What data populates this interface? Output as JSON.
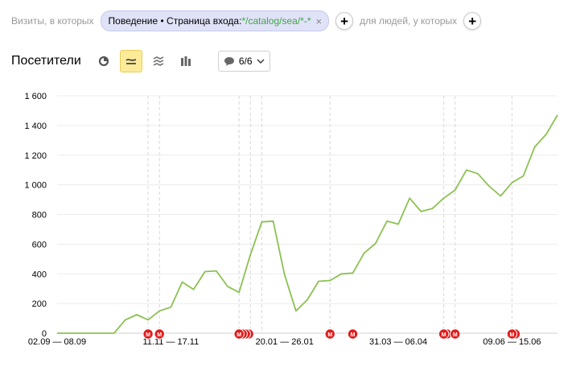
{
  "filters": {
    "visits_label": "Визиты, в которых",
    "segment": {
      "prefix": "Поведение • Страница входа: ",
      "value": "*/catalog/sea/*-*"
    },
    "people_label": "для людей, у которых",
    "add_symbol": "+",
    "remove_symbol": "×"
  },
  "toolbar": {
    "metric_title": "Посетители",
    "view_modes": [
      "pie-chart-icon",
      "line-chart-icon",
      "area-chart-icon",
      "bar-chart-icon"
    ],
    "active_view": "line-chart-icon",
    "notes_label": "6/6",
    "accent": "#fdeb9a"
  },
  "chart_data": {
    "type": "line",
    "color": "#8cc152",
    "ylim": [
      0,
      1600
    ],
    "yticks": [
      "0",
      "200",
      "400",
      "600",
      "800",
      "1 000",
      "1 200",
      "1 400",
      "1 600"
    ],
    "xtick_labels": [
      "02.09 — 08.09",
      "11.11 — 17.11",
      "20.01 — 26.01",
      "31.03 — 06.04",
      "09.06 — 15.06"
    ],
    "xtick_index": [
      0,
      10,
      20,
      30,
      40
    ],
    "values": [
      0,
      0,
      0,
      0,
      0,
      0,
      90,
      125,
      90,
      150,
      175,
      345,
      295,
      415,
      420,
      315,
      275,
      530,
      750,
      755,
      395,
      150,
      225,
      350,
      355,
      400,
      405,
      540,
      605,
      755,
      735,
      910,
      820,
      840,
      910,
      965,
      1100,
      1075,
      990,
      925,
      1015,
      1060,
      1255,
      1340,
      1470
    ],
    "grid": true,
    "note_marker_letter": "М",
    "note_marker_color": "#e01d1d",
    "note_groups": [
      {
        "index": 8,
        "count": 1
      },
      {
        "index": 9,
        "count": 1
      },
      {
        "index": 16,
        "count": 4
      },
      {
        "index": 24,
        "count": 1
      },
      {
        "index": 26,
        "count": 1
      },
      {
        "index": 34,
        "count": 2
      },
      {
        "index": 35,
        "count": 1
      },
      {
        "index": 40,
        "count": 2
      }
    ],
    "dashed_lines_index": [
      8,
      9,
      16,
      17,
      18,
      24,
      34,
      35,
      40
    ]
  }
}
